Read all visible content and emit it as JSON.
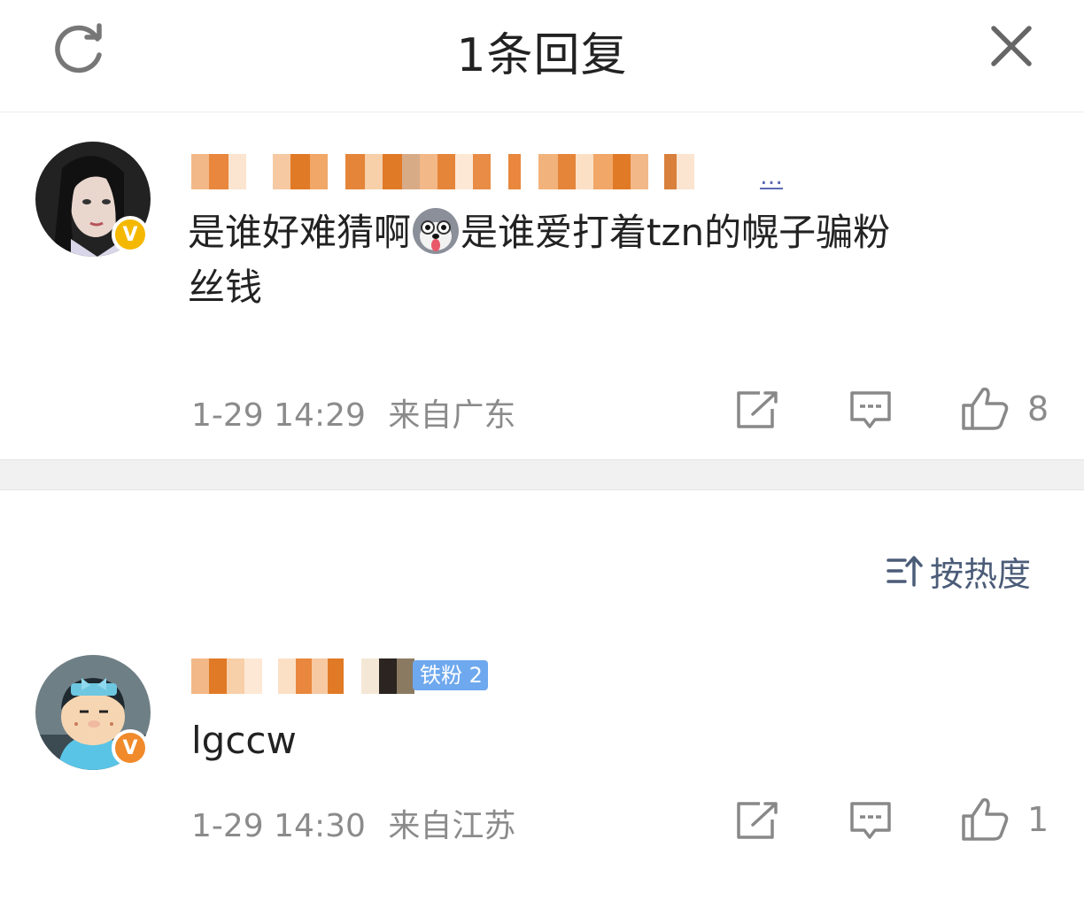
{
  "header": {
    "title": "1条回复",
    "refresh_icon": "refresh-icon",
    "close_icon": "close-icon"
  },
  "main_comment": {
    "verified_color": "#f5b800",
    "text_before_emoji": "是谁好难猜啊",
    "emoji": "husky-dog-emoji",
    "text_after_emoji": "是谁爱打着tzn的幌子骗粉",
    "text_line2": "丝钱",
    "more": "…",
    "timestamp": "1-29 14:29",
    "location": "来自广东",
    "likes": "8"
  },
  "sort": {
    "icon": "sort-icon",
    "label": "按热度"
  },
  "reply": {
    "verified_color": "#f08a2b",
    "fan_badge": "铁粉 2",
    "text": "lgccw",
    "timestamp": "1-29 14:30",
    "location": "来自江苏",
    "likes": "1"
  }
}
